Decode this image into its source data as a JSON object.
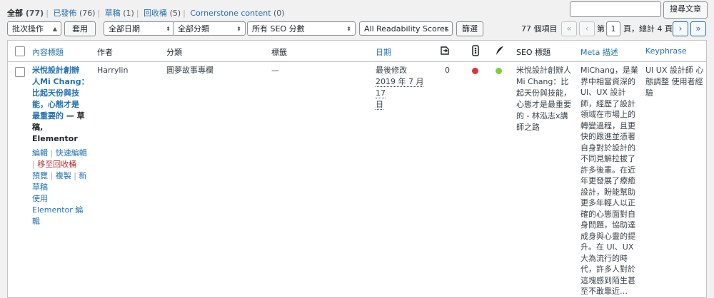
{
  "filters": {
    "all_label": "全部",
    "all_count": "(77)",
    "published_label": "已發佈",
    "published_count": "(76)",
    "draft_label": "草稿",
    "draft_count": "(1)",
    "trash_label": "回收桶",
    "trash_count": "(5)",
    "cornerstone_label": "Cornerstone content",
    "cornerstone_count": "(0)"
  },
  "search": {
    "value": "",
    "button_label": "搜尋文章"
  },
  "tablenav": {
    "bulk_action": "批次操作",
    "apply_label": "套用",
    "date_filter": "全部日期",
    "category_filter": "全部分類",
    "seo_filter": "所有 SEO 分數",
    "readability_filter": "All Readability Scores",
    "filter_label": "篩選",
    "items_count": "77 個項目",
    "page_prefix": "第",
    "current_page": "1",
    "page_suffix": "頁，總計 4 頁",
    "first": "«",
    "prev": "‹",
    "next": "›",
    "last": "»"
  },
  "columns": {
    "title": "內容標題",
    "author": "作者",
    "category": "分類",
    "tags": "標籤",
    "date": "日期",
    "seo_title": "SEO 標題",
    "meta_desc": "Meta 描述",
    "keyphrase": "Keyphrase",
    "icons": [
      "links-icon",
      "seo-score-icon",
      "readability-icon"
    ]
  },
  "row": {
    "title_lines": [
      "米悅設計創辦",
      "人Mi Chang：",
      "比起天份與技",
      "能，心態才是",
      "最重要的"
    ],
    "state": "— 草稿, Elementor",
    "actions": {
      "edit": "編輯",
      "quick_edit": "快速編輯",
      "trash": "移至回收桶",
      "preview": "預覽",
      "copy": "複製",
      "new_draft": "新草稿",
      "elementor": "使用 Elementor 編輯"
    },
    "author": "Harrylin",
    "category": "圓夢故事專欄",
    "tags": "—",
    "date_status": "最後修改",
    "date_lines": [
      "2019 年 7 月 17",
      "日"
    ],
    "links_count": "0",
    "seo_score_color": "#dc3232",
    "readability_color": "#7ad03a",
    "seo_title_lines": [
      "米悅設計創辦人",
      "Mi Chang：比",
      "起天份與技能，",
      "心態才是最重要",
      "的 - 林泓志x講",
      "師之路"
    ],
    "meta_lines": [
      "MiChang，是業",
      "界中相當資深的",
      "UI、UX 設計",
      "師，經歷了設計",
      "領域在市場上的",
      "轉變過程，且更",
      "快的跟進並憑著",
      "自身對於設計的",
      "不同見解拉拔了",
      "許多後輩。在近",
      "年更發展了療癒",
      "設計，盼能幫助",
      "更多年輕人以正",
      "確的心態面對自",
      "身問題，協助達",
      "成身與心靈的提",
      "升。在 UI、UX",
      "大為流行的時",
      "代，許多人對於",
      "這塊感到陌生甚",
      "至不敢靠近…"
    ],
    "keyphrase_lines": [
      "UI UX 設計師 心",
      "態調整 使用者經",
      "驗"
    ]
  }
}
